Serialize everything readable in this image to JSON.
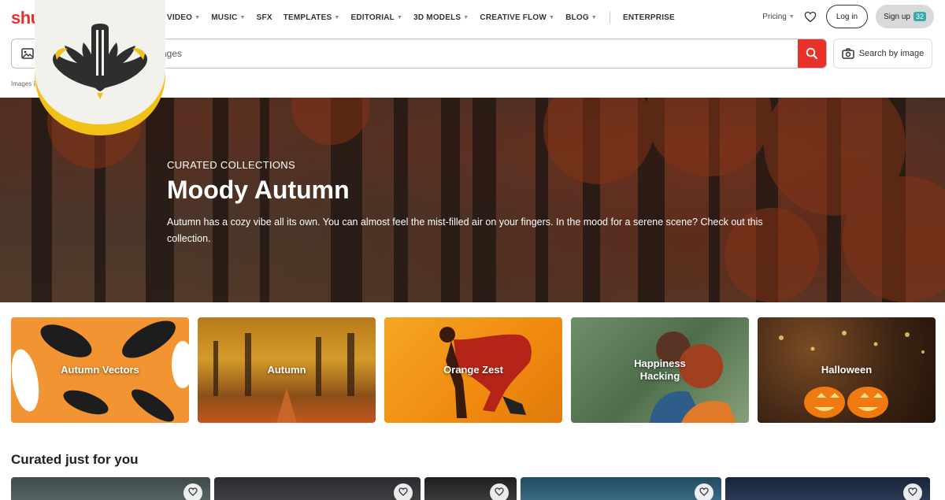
{
  "brand": {
    "name": "shu"
  },
  "nav": {
    "items": [
      {
        "label": "VIDEO",
        "caret": true
      },
      {
        "label": "MUSIC",
        "caret": true
      },
      {
        "label": "SFX",
        "caret": false
      },
      {
        "label": "TEMPLATES",
        "caret": true
      },
      {
        "label": "EDITORIAL",
        "caret": true
      },
      {
        "label": "3D MODELS",
        "caret": true
      },
      {
        "label": "CREATIVE FLOW",
        "caret": true
      },
      {
        "label": "BLOG",
        "caret": true
      }
    ],
    "enterprise": "ENTERPRISE",
    "pricing": "Pricing",
    "login": "Log in",
    "signup": "Sign up",
    "signup_badge": "32"
  },
  "search": {
    "value": "ages",
    "search_by_image": "Search by image"
  },
  "breadcrumb": "Images i",
  "hero": {
    "eyebrow": "CURATED COLLECTIONS",
    "title": "Moody Autumn",
    "description": "Autumn has a cozy vibe all its own. You can almost feel the mist-filled air on your fingers. In the mood for a serene scene? Check out this collection."
  },
  "collections": [
    {
      "label": "Autumn Vectors"
    },
    {
      "label": "Autumn"
    },
    {
      "label": "Orange Zest"
    },
    {
      "label": "Happiness Hacking"
    },
    {
      "label": "Halloween"
    }
  ],
  "curated": {
    "title": "Curated just for you"
  },
  "colors": {
    "accent": "#e8312b",
    "logo_gold": "#f2c118",
    "logo_dark": "#2e2e2e"
  },
  "icons": [
    "image-icon",
    "search-icon",
    "camera-icon",
    "heart-icon",
    "chevron-down-icon"
  ]
}
